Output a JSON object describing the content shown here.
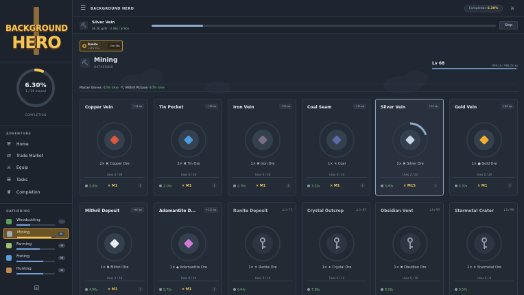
{
  "sidebar": {
    "logo": {
      "line1": "BACKGROUND",
      "line2": "HERO"
    },
    "completion": {
      "value": "6.30%",
      "sub": "1 / 16 maxed",
      "caption": "COMPLETION",
      "fraction": 0.063
    },
    "adventure_title": "ADVENTURE",
    "adventure": [
      {
        "label": "Home",
        "icon": "shield-icon"
      },
      {
        "label": "Trade Market",
        "icon": "trade-icon"
      },
      {
        "label": "Equip",
        "icon": "armor-icon"
      },
      {
        "label": "Tasks",
        "icon": "tasks-icon"
      },
      {
        "label": "Completion",
        "icon": "trophy-icon"
      }
    ],
    "gathering_title": "GATHERING",
    "gathering": [
      {
        "label": "Woodcutting",
        "count": "–",
        "progress": 0.35,
        "color": "#5aa05a"
      },
      {
        "label": "Mining",
        "count": "68",
        "progress": 0.9,
        "color": "#a3a9b3"
      },
      {
        "label": "Farming",
        "count": "46",
        "progress": 0.6,
        "color": "#9bc46b"
      },
      {
        "label": "Fishing",
        "count": "59",
        "progress": 0.7,
        "color": "#5ba0d6"
      },
      {
        "label": "Hunting",
        "count": "59",
        "progress": 0.7,
        "color": "#c08a55"
      }
    ]
  },
  "topbar": {
    "title": "BACKGROUND HERO",
    "completion_label": "Completion",
    "completion_value": "6.30%"
  },
  "activity": {
    "name": "Silver Vein",
    "rate": "36.2k xp/hr",
    "rate_extra": "2.48x / action",
    "progress": 0.15,
    "stop_label": "Stop"
  },
  "buff": {
    "name": "Runite",
    "sub": "+12% time",
    "time": "13m 58s"
  },
  "skill": {
    "name": "Mining",
    "category": "GATHERING",
    "level": "Lv 68",
    "xp": "969.1k / 988.2k xp",
    "progress": 0.98
  },
  "equipment": {
    "item1": "Master Gloves",
    "item1_bonus": "-10% time",
    "item2": "Mithril Pickaxe",
    "item2_bonus": "-10% time"
  },
  "nodes": [
    {
      "name": "Copper Vein",
      "xp": "+14 xp",
      "output": "2× ✖ Copper Ore",
      "uses": "Uses 0 / 30",
      "rate": "2.45s",
      "multiplier": "× M1",
      "color": "#e0563b",
      "locked": false
    },
    {
      "name": "Tin Pocket",
      "xp": "+18 xp",
      "output": "2× ✖ Tin Ore",
      "uses": "Uses 0 / 28",
      "rate": "2.16s",
      "multiplier": "× M1",
      "color": "#4c9be0",
      "locked": false
    },
    {
      "name": "Iron Vein",
      "xp": "+25 xp",
      "output": "1× ✖ Iron Ore",
      "uses": "Uses 0 / 26",
      "rate": "2.70s",
      "multiplier": "× M1",
      "color": "#7a6f88",
      "locked": false
    },
    {
      "name": "Coal Seam",
      "xp": "+35 xp",
      "output": "1× ✕ Coal",
      "uses": "Uses 0 / 24",
      "rate": "3.32s",
      "multiplier": "× M1",
      "color": "#5c6aa8",
      "locked": false
    },
    {
      "name": "Silver Vein",
      "xp": "+52 xp",
      "output": "1× ✖ Silver Ore",
      "uses": "Uses 2 / 22",
      "rate": "3.40s",
      "multiplier": "× M15",
      "color": "#c9d4e6",
      "locked": false,
      "selected": true,
      "progress": 0.2
    },
    {
      "name": "Gold Vein",
      "xp": "+60 xp",
      "output": "1× ● Gold Ore",
      "uses": "Uses 0 / 20",
      "rate": "4.32s",
      "multiplier": "× M1",
      "color": "#f0b02e",
      "locked": false
    },
    {
      "name": "Mithril Deposit",
      "xp": "+80 xp",
      "output": "1× ✖ Mithril Ore",
      "uses": "Uses 0 / 18",
      "rate": "4.90s",
      "multiplier": "× M1",
      "color": "#e8ecf4",
      "locked": false
    },
    {
      "name": "Adamantite D...",
      "xp": "+112 xp",
      "output": "1× ◆ Adamantite Ore",
      "uses": "Uses 0 / 16",
      "rate": "5.73s",
      "multiplier": "× M1",
      "color": "#d27ad8",
      "locked": false
    },
    {
      "name": "Runite Deposit",
      "level": "Lv 72",
      "output": "1× ✕ Runite Ore",
      "uses": "Uses 0 / 14",
      "rate": "6.04s",
      "locked": true
    },
    {
      "name": "Crystal Outcrop",
      "level": "Lv 83",
      "output": "1× ✦ Crystal Ore",
      "uses": "Uses 0 / 12",
      "rate": "7.38s",
      "locked": true
    },
    {
      "name": "Obsidian Vent",
      "level": "Lv 94",
      "output": "1× ✖ Obsidian Ore",
      "uses": "Uses 0 / 10",
      "rate": "8.28s",
      "locked": true
    },
    {
      "name": "Starmetal Crater",
      "level": "Lv 98",
      "output": "1× ✕ Starmetal Ore",
      "uses": "Uses 0 / 8",
      "rate": "9.57s",
      "locked": true
    }
  ]
}
